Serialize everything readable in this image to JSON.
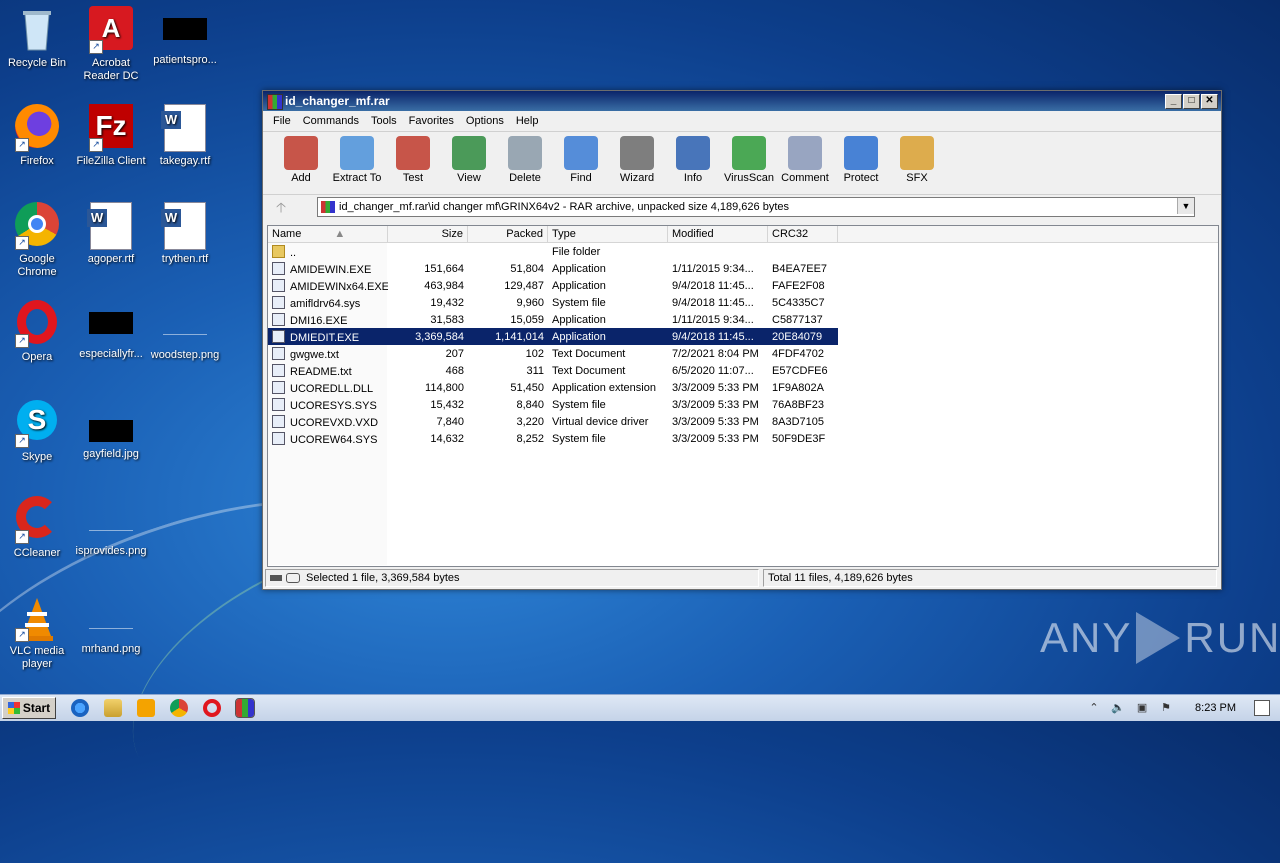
{
  "desktop": {
    "icons": [
      {
        "label": "Recycle Bin"
      },
      {
        "label": "Acrobat Reader DC"
      },
      {
        "label": "patientspro..."
      },
      {
        "label": "Firefox"
      },
      {
        "label": "FileZilla Client"
      },
      {
        "label": "takegay.rtf"
      },
      {
        "label": "Google Chrome"
      },
      {
        "label": "agoper.rtf"
      },
      {
        "label": "trythen.rtf"
      },
      {
        "label": "Opera"
      },
      {
        "label": "especiallyfr..."
      },
      {
        "label": "woodstep.png"
      },
      {
        "label": "Skype"
      },
      {
        "label": "gayfield.jpg"
      },
      {
        "label": "CCleaner"
      },
      {
        "label": "isprovides.png"
      },
      {
        "label": "VLC media player"
      },
      {
        "label": "mrhand.png"
      }
    ]
  },
  "window": {
    "title": "id_changer_mf.rar",
    "buttons": {
      "minimize": "_",
      "maximize": "□",
      "close": "✕"
    },
    "menu": [
      "File",
      "Commands",
      "Tools",
      "Favorites",
      "Options",
      "Help"
    ],
    "toolbar": [
      {
        "label": "Add",
        "icon": "add-archive-icon",
        "color": "#c0392b"
      },
      {
        "label": "Extract To",
        "icon": "extract-folder-icon",
        "color": "#4a90d9"
      },
      {
        "label": "Test",
        "icon": "test-clipboard-icon",
        "color": "#c0392b"
      },
      {
        "label": "View",
        "icon": "view-book-icon",
        "color": "#2e8b3e"
      },
      {
        "label": "Delete",
        "icon": "trash-icon",
        "color": "#8a9aa8"
      },
      {
        "label": "Find",
        "icon": "magnifier-icon",
        "color": "#3a7bd5"
      },
      {
        "label": "Wizard",
        "icon": "wand-icon",
        "color": "#6a6a6a"
      },
      {
        "label": "Info",
        "icon": "info-icon",
        "color": "#2a5fb0"
      },
      {
        "label": "VirusScan",
        "icon": "virus-scan-icon",
        "color": "#2e9b3a"
      },
      {
        "label": "Comment",
        "icon": "comment-icon",
        "color": "#8898b8"
      },
      {
        "label": "Protect",
        "icon": "shield-icon",
        "color": "#2a6fd0"
      },
      {
        "label": "SFX",
        "icon": "sfx-box-icon",
        "color": "#d9a030"
      }
    ],
    "address": "id_changer_mf.rar\\id changer mf\\GRINX64v2 - RAR archive, unpacked size 4,189,626 bytes",
    "columns": {
      "name": "Name",
      "size": "Size",
      "packed": "Packed",
      "type": "Type",
      "modified": "Modified",
      "crc": "CRC32"
    },
    "files": [
      {
        "name": "..",
        "size": "",
        "packed": "",
        "type": "File folder",
        "modified": "",
        "crc": "",
        "icon": "folder"
      },
      {
        "name": "AMIDEWIN.EXE",
        "size": "151,664",
        "packed": "51,804",
        "type": "Application",
        "modified": "1/11/2015 9:34...",
        "crc": "B4EA7EE7",
        "icon": "app"
      },
      {
        "name": "AMIDEWINx64.EXE",
        "size": "463,984",
        "packed": "129,487",
        "type": "Application",
        "modified": "9/4/2018 11:45...",
        "crc": "FAFE2F08",
        "icon": "app"
      },
      {
        "name": "amifldrv64.sys",
        "size": "19,432",
        "packed": "9,960",
        "type": "System file",
        "modified": "9/4/2018 11:45...",
        "crc": "5C4335C7",
        "icon": "sys"
      },
      {
        "name": "DMI16.EXE",
        "size": "31,583",
        "packed": "15,059",
        "type": "Application",
        "modified": "1/11/2015 9:34...",
        "crc": "C5877137",
        "icon": "app"
      },
      {
        "name": "DMIEDIT.EXE",
        "size": "3,369,584",
        "packed": "1,141,014",
        "type": "Application",
        "modified": "9/4/2018 11:45...",
        "crc": "20E84079",
        "icon": "app",
        "selected": true
      },
      {
        "name": "gwgwe.txt",
        "size": "207",
        "packed": "102",
        "type": "Text Document",
        "modified": "7/2/2021 8:04 PM",
        "crc": "4FDF4702",
        "icon": "txt"
      },
      {
        "name": "README.txt",
        "size": "468",
        "packed": "311",
        "type": "Text Document",
        "modified": "6/5/2020 11:07...",
        "crc": "E57CDFE6",
        "icon": "txt"
      },
      {
        "name": "UCOREDLL.DLL",
        "size": "114,800",
        "packed": "51,450",
        "type": "Application extension",
        "modified": "3/3/2009 5:33 PM",
        "crc": "1F9A802A",
        "icon": "sys"
      },
      {
        "name": "UCORESYS.SYS",
        "size": "15,432",
        "packed": "8,840",
        "type": "System file",
        "modified": "3/3/2009 5:33 PM",
        "crc": "76A8BF23",
        "icon": "sys"
      },
      {
        "name": "UCOREVXD.VXD",
        "size": "7,840",
        "packed": "3,220",
        "type": "Virtual device driver",
        "modified": "3/3/2009 5:33 PM",
        "crc": "8A3D7105",
        "icon": "sys"
      },
      {
        "name": "UCOREW64.SYS",
        "size": "14,632",
        "packed": "8,252",
        "type": "System file",
        "modified": "3/3/2009 5:33 PM",
        "crc": "50F9DE3F",
        "icon": "sys"
      }
    ],
    "status_left": "Selected 1 file, 3,369,584 bytes",
    "status_right": "Total 11 files, 4,189,626 bytes"
  },
  "taskbar": {
    "start_label": "Start",
    "clock": "8:23 PM"
  },
  "watermark": {
    "left": "ANY",
    "right": "RUN"
  }
}
